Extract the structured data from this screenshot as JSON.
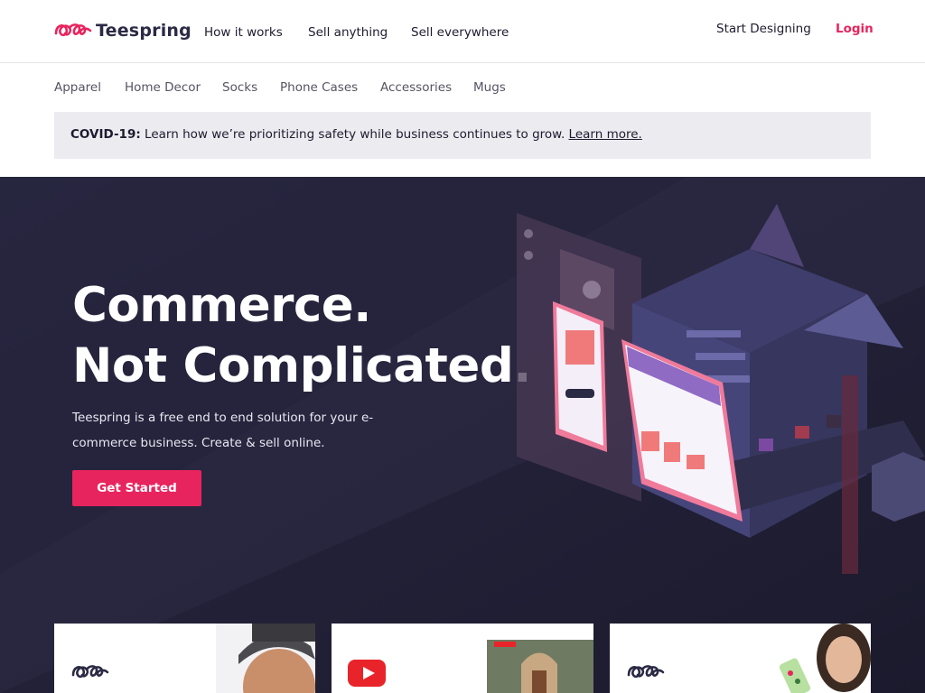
{
  "header": {
    "brand": "Teespring",
    "nav": [
      "How it works",
      "Sell anything",
      "Sell everywhere"
    ],
    "start_designing": "Start Designing",
    "login": "Login"
  },
  "categories": [
    "Apparel",
    "Home Decor",
    "Socks",
    "Phone Cases",
    "Accessories",
    "Mugs"
  ],
  "banner": {
    "label": "COVID-19:",
    "text": "Learn how we’re prioritizing safety while business continues to grow.",
    "link": "Learn more."
  },
  "hero": {
    "headline_1": "Commerce.",
    "headline_2": "Not Complicated.",
    "subtext": "Teespring is a free end to end solution for your e-commerce business. Create & sell online.",
    "cta": "Get Started"
  },
  "cards": [
    {
      "icon": "teespring-logo-icon"
    },
    {
      "icon": "youtube-icon"
    },
    {
      "icon": "teespring-logo-icon"
    }
  ],
  "colors": {
    "accent": "#e8245e",
    "hero_bg": "#23213a",
    "banner_bg": "#ecebf0",
    "brand_text": "#2b2a45"
  }
}
